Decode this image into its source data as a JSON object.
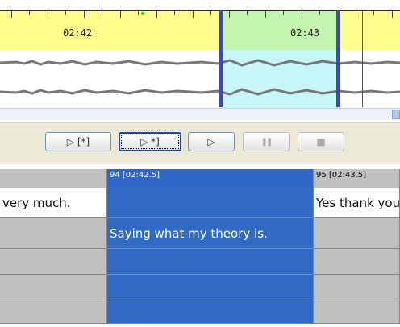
{
  "timeline": {
    "time_labels": [
      "02:42",
      "02:43"
    ],
    "colors": {
      "ruler": "#ffff8c",
      "selection_ruler": "#c4f5ae",
      "selection_wave": "#c6f6f7",
      "cursor": "#3b49c4"
    }
  },
  "controls": {
    "play_from_start_label": "▷ [*]",
    "play_to_end_label": "▷ *]",
    "play_icon": "▷",
    "pause_icon": "❚❚",
    "stop_icon": "■"
  },
  "grid": {
    "headers": [
      "",
      "94 [02:42.5]",
      "95 [02:43.5]"
    ],
    "rows": [
      [
        "very much.",
        "",
        "Yes thank you"
      ],
      [
        "",
        "Saying what my theory is.",
        ""
      ],
      [
        "",
        "",
        ""
      ],
      [
        "",
        "",
        ""
      ],
      [
        "",
        "",
        ""
      ]
    ],
    "colors": {
      "selected": "#316ac5",
      "empty": "#c0c0c0"
    }
  }
}
